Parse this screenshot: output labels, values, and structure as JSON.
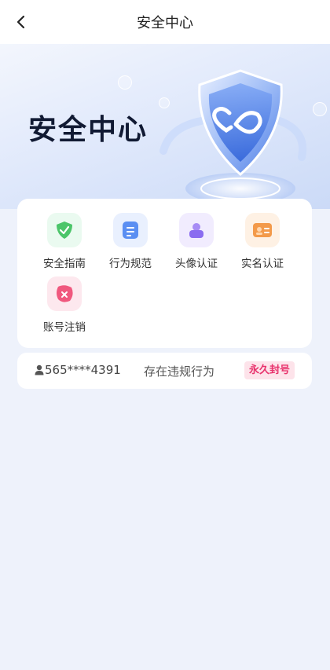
{
  "navbar": {
    "title": "安全中心"
  },
  "hero": {
    "title": "安全中心"
  },
  "menu": {
    "items": [
      {
        "label": "安全指南",
        "icon": "shield-check-icon",
        "color": "#4cc56a",
        "bg": "#eafaf0"
      },
      {
        "label": "行为规范",
        "icon": "document-icon",
        "color": "#5b8ff2",
        "bg": "#e9f0fe"
      },
      {
        "label": "头像认证",
        "icon": "avatar-verify-icon",
        "color": "#8a6cf0",
        "bg": "#f1ecfe"
      },
      {
        "label": "实名认证",
        "icon": "id-card-icon",
        "color": "#f39a4a",
        "bg": "#fef1e4"
      },
      {
        "label": "账号注销",
        "icon": "account-cancel-icon",
        "color": "#f0587e",
        "bg": "#fde8ee"
      }
    ]
  },
  "account": {
    "number": "565****4391",
    "status": "存在违规行为",
    "badge": "永久封号"
  }
}
